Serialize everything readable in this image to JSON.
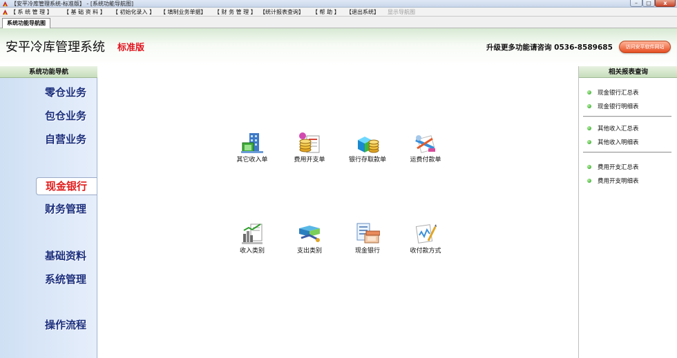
{
  "window": {
    "title": "【安平冷库管理系统-标准版】 - [系统功能导航图]",
    "min_glyph": "–",
    "max_glyph": "□",
    "close_glyph": "x"
  },
  "menu": [
    {
      "label": "【 系 统 管 理 】"
    },
    {
      "label": "【 基 础 资 料 】"
    },
    {
      "label": "【 初始化录入 】"
    },
    {
      "label": "【 填制业务单据】"
    },
    {
      "label": "【 财 务 管 理 】"
    },
    {
      "label": "【统计报表查询】"
    },
    {
      "label": "【 帮 助 】"
    },
    {
      "label": "【退出系统】"
    },
    {
      "label": "显示导航图"
    }
  ],
  "tab": {
    "label": "系统功能导航图"
  },
  "header": {
    "title": "安平冷库管理系统",
    "edition": "标准版",
    "upgrade_text": "升级更多功能请咨询  0536-8589685",
    "visit_button": "访问安平软件网站"
  },
  "leftnav": {
    "header": "系统功能导航",
    "items": [
      {
        "label": "零仓业务"
      },
      {
        "label": "包仓业务"
      },
      {
        "label": "自营业务"
      },
      {
        "label": "现金银行"
      },
      {
        "label": "财务管理"
      },
      {
        "label": "基础资料"
      },
      {
        "label": "系统管理"
      },
      {
        "label": "操作流程"
      }
    ]
  },
  "main": {
    "tiles": [
      {
        "label": "其它收入单",
        "icon": "building-money-icon"
      },
      {
        "label": "费用开支单",
        "icon": "coins-document-icon"
      },
      {
        "label": "银行存取款单",
        "icon": "bank-deposit-icon"
      },
      {
        "label": "运费付款单",
        "icon": "freight-payment-icon"
      },
      {
        "label": "收入类别",
        "icon": "income-category-icon"
      },
      {
        "label": "支出类别",
        "icon": "expense-category-icon"
      },
      {
        "label": "现金银行",
        "icon": "cash-bank-icon"
      },
      {
        "label": "收付款方式",
        "icon": "payment-method-icon"
      }
    ]
  },
  "rightpanel": {
    "header": "相关报表查询",
    "links": [
      {
        "label": "现金银行汇总表"
      },
      {
        "label": "现金银行明细表"
      },
      {
        "label": "其他收入汇总表"
      },
      {
        "label": "其他收入明细表"
      },
      {
        "label": "费用开支汇总表"
      },
      {
        "label": "费用开支明细表"
      }
    ]
  },
  "colors": {
    "active_nav": "#e01a1a",
    "nav_text": "#1b2f7e",
    "edition_red": "#e0141e",
    "status_dot": "#1f9a1a"
  }
}
